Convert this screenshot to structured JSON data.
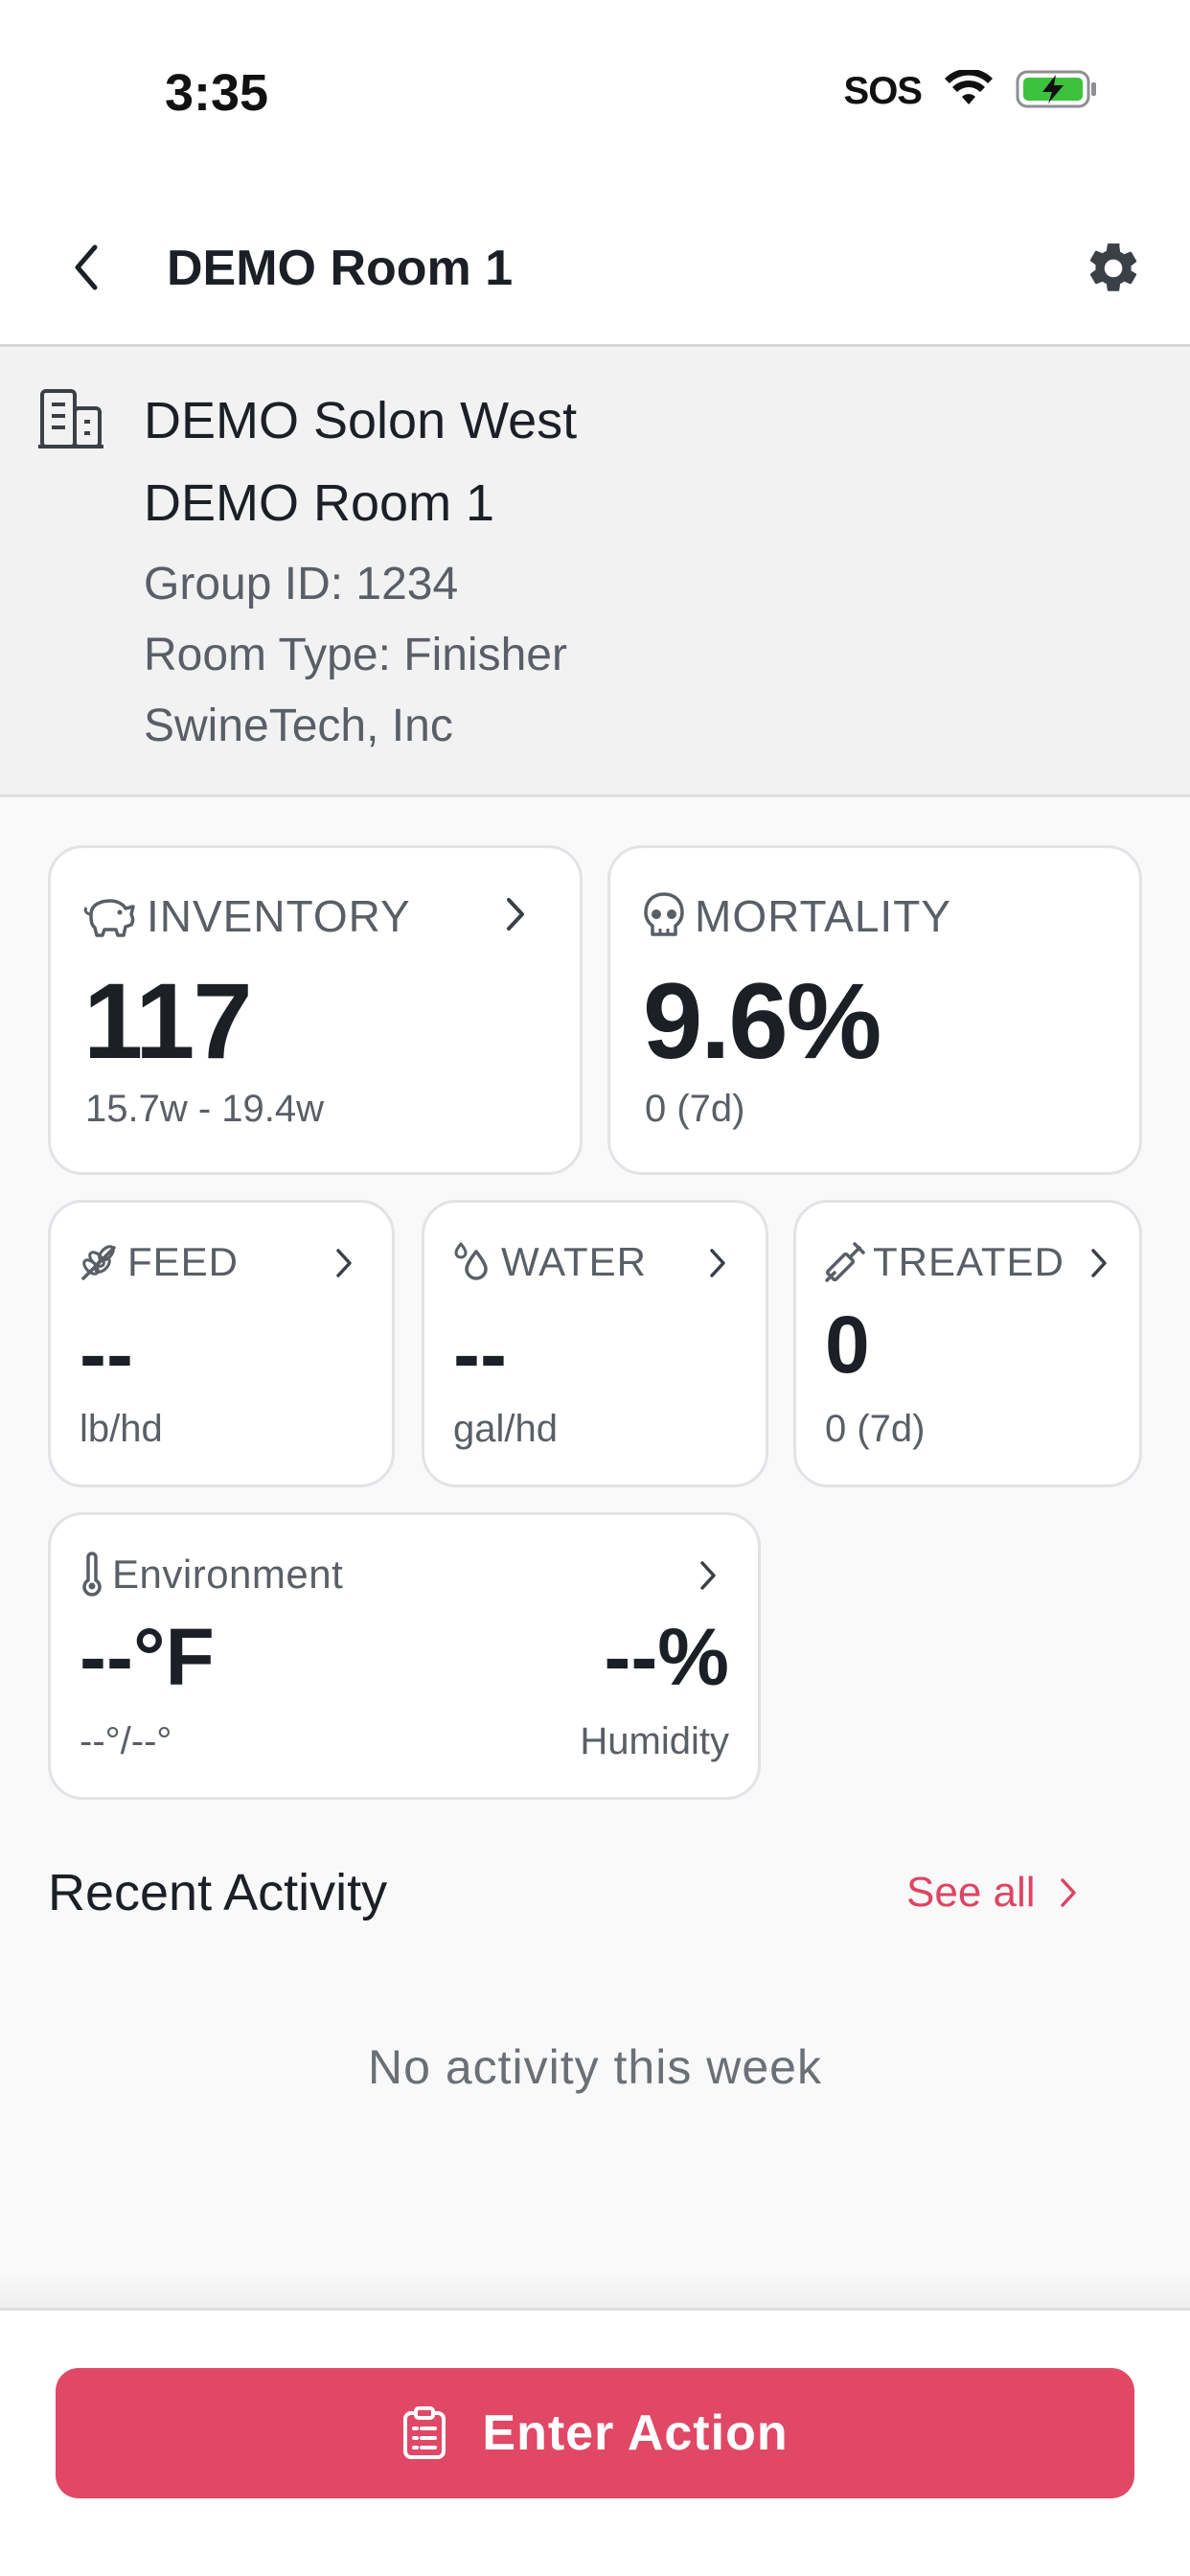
{
  "status_bar": {
    "time": "3:35",
    "sos": "SOS"
  },
  "nav": {
    "title": "DEMO Room 1"
  },
  "info": {
    "site": "DEMO Solon West",
    "room": "DEMO Room 1",
    "group_id": "Group ID: 1234",
    "room_type": "Room Type: Finisher",
    "company": "SwineTech, Inc"
  },
  "cards": {
    "inventory": {
      "label": "INVENTORY",
      "value": "117",
      "sub": "15.7w - 19.4w"
    },
    "mortality": {
      "label": "MORTALITY",
      "value": "9.6%",
      "sub": "0 (7d)"
    },
    "feed": {
      "label": "FEED",
      "value": "--",
      "sub": "lb/hd"
    },
    "water": {
      "label": "WATER",
      "value": "--",
      "sub": "gal/hd"
    },
    "treated": {
      "label": "TREATED",
      "value": "0",
      "sub": "0 (7d)"
    },
    "environment": {
      "label": "Environment",
      "temp": "--°F",
      "temp_range": "--°/--°",
      "humidity": "--%",
      "humidity_label": "Humidity"
    }
  },
  "recent": {
    "title": "Recent Activity",
    "see_all": "See all",
    "empty": "No activity this week"
  },
  "footer": {
    "action_label": "Enter Action"
  },
  "colors": {
    "accent": "#e04865",
    "link": "#dc4563",
    "text": "#1c1f26",
    "muted": "#5a5e66",
    "battery": "#3cc23c"
  }
}
